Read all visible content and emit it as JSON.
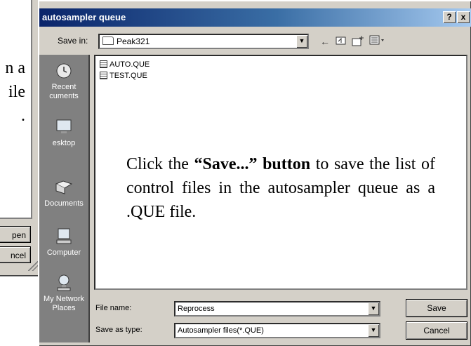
{
  "background_dialog": {
    "partial_text": "n a\nile\n.",
    "open_button": "pen",
    "cancel_button": "ncel"
  },
  "dialog": {
    "title": "autosampler queue",
    "help_button": "?",
    "close_button": "x",
    "save_in_label": "Save in:",
    "save_in_value": "Peak321",
    "toolbar": {
      "back_icon": "back-arrow-icon",
      "up_icon": "up-folder-icon",
      "new_folder_icon": "new-folder-icon",
      "view_icon": "view-menu-icon"
    },
    "places": [
      {
        "label": "Recent\ncuments",
        "icon": "recent-documents-icon"
      },
      {
        "label": "esktop",
        "icon": "desktop-icon"
      },
      {
        "label": "Documents",
        "icon": "my-documents-icon"
      },
      {
        "label": "Computer",
        "icon": "my-computer-icon"
      },
      {
        "label": "My Network\nPlaces",
        "icon": "network-places-icon"
      }
    ],
    "files": [
      "AUTO.QUE",
      "TEST.QUE"
    ],
    "file_name_label": "File name:",
    "file_name_value": "Reprocess",
    "save_type_label": "Save as type:",
    "save_type_value": "Autosampler files(*.QUE)",
    "save_button": "Save",
    "cancel_button": "Cancel"
  },
  "instructions": {
    "pre": "Click the ",
    "bold": "“Save...” button",
    "post": " to save the list of control files in the autosampler queue as a .QUE file."
  }
}
